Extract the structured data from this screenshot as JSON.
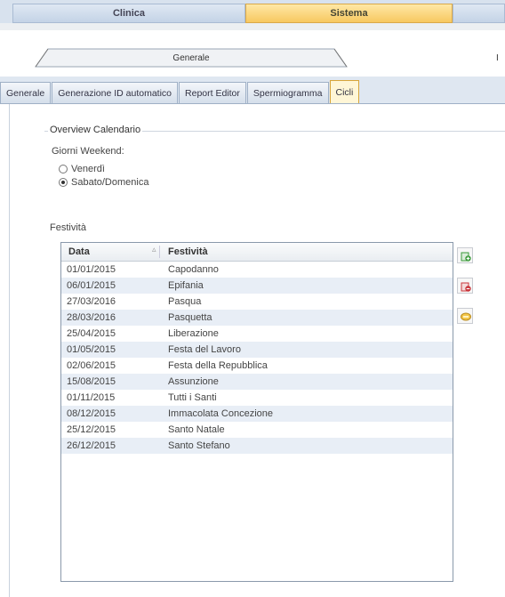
{
  "top_tabs": {
    "clinica": "Clinica",
    "sistema": "Sistema"
  },
  "section_tab": {
    "label": "Generale",
    "edge_glyph": "I"
  },
  "sub_tabs": [
    {
      "label": "Generale"
    },
    {
      "label": "Generazione ID automatico"
    },
    {
      "label": "Report Editor"
    },
    {
      "label": "Spermiogramma"
    },
    {
      "label": "Cicli"
    }
  ],
  "calendar": {
    "title": "Overview Calendario",
    "weekend_label": "Giorni Weekend:",
    "options": [
      {
        "label": "Venerdì",
        "selected": false
      },
      {
        "label": "Sabato/Domenica",
        "selected": true
      }
    ]
  },
  "holidays": {
    "title": "Festività",
    "columns": {
      "date": "Data",
      "holiday": "Festività"
    },
    "rows": [
      {
        "date": "01/01/2015",
        "name": "Capodanno"
      },
      {
        "date": "06/01/2015",
        "name": "Epifania"
      },
      {
        "date": "27/03/2016",
        "name": "Pasqua"
      },
      {
        "date": "28/03/2016",
        "name": "Pasquetta"
      },
      {
        "date": "25/04/2015",
        "name": "Liberazione"
      },
      {
        "date": "01/05/2015",
        "name": "Festa del Lavoro"
      },
      {
        "date": "02/06/2015",
        "name": "Festa della Repubblica"
      },
      {
        "date": "15/08/2015",
        "name": "Assunzione"
      },
      {
        "date": "01/11/2015",
        "name": "Tutti i Santi"
      },
      {
        "date": "08/12/2015",
        "name": "Immacolata Concezione"
      },
      {
        "date": "25/12/2015",
        "name": "Santo Natale"
      },
      {
        "date": "26/12/2015",
        "name": "Santo Stefano"
      }
    ]
  },
  "actions": [
    {
      "icon": "add-icon",
      "color": "#3a9a3a"
    },
    {
      "icon": "remove-icon",
      "color": "#c8343a"
    },
    {
      "icon": "edit-icon",
      "color": "#e3b02e"
    }
  ]
}
